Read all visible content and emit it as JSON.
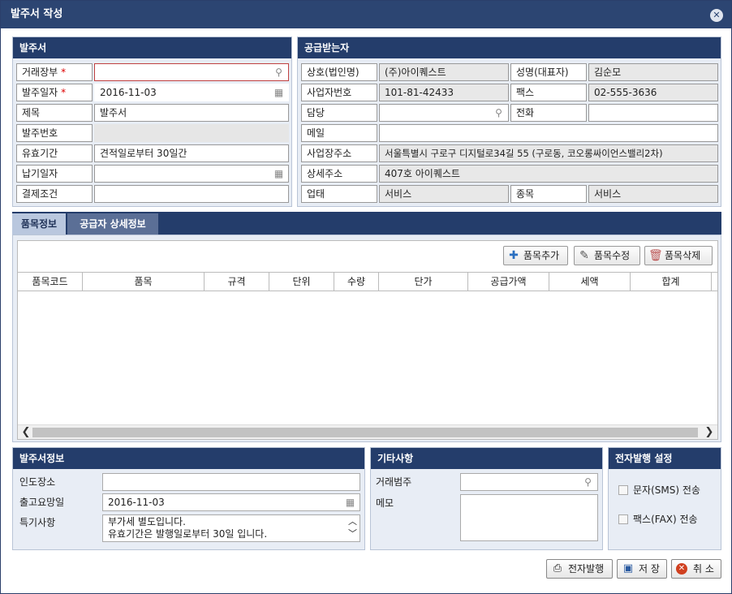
{
  "window": {
    "title": "발주서 작성",
    "close_icon": "close-icon"
  },
  "order": {
    "header": "발주서",
    "fields": [
      {
        "label": "거래장부",
        "required": "*",
        "value": ""
      },
      {
        "label": "발주일자",
        "required": "*",
        "value": "2016-11-03"
      },
      {
        "label": "제목",
        "value": "발주서"
      },
      {
        "label": "발주번호",
        "value": ""
      },
      {
        "label": "유효기간",
        "value": "견적일로부터 30일간"
      },
      {
        "label": "납기일자",
        "value": ""
      },
      {
        "label": "결제조건",
        "value": ""
      }
    ]
  },
  "supplier": {
    "header": "공급받는자",
    "company_label": "상호(법인명)",
    "company_value": "(주)아이퀘스트",
    "ceo_label": "성명(대표자)",
    "ceo_value": "김순모",
    "bizno_label": "사업자번호",
    "bizno_value": "101-81-42433",
    "fax_label": "팩스",
    "fax_value": "02-555-3636",
    "manager_label": "담당",
    "manager_value": "",
    "phone_label": "전화",
    "phone_value": "",
    "email_label": "메일",
    "email_value": "",
    "address_label": "사업장주소",
    "address_value": "서울특별시 구로구 디지털로34길 55 (구로동, 코오롱싸이언스밸리2차)",
    "detail_label": "상세주소",
    "detail_value": "407호 아이퀘스트",
    "biztype_label": "업태",
    "biztype_value": "서비스",
    "item_label": "종목",
    "item_value": "서비스"
  },
  "tabs": [
    "품목정보",
    "공급자 상세정보"
  ],
  "toolbar": {
    "add": "품목추가",
    "edit": "품목수정",
    "delete": "품목삭제"
  },
  "columns": [
    "품목코드",
    "품목",
    "규격",
    "단위",
    "수량",
    "단가",
    "공급가액",
    "세액",
    "합계"
  ],
  "rows": [],
  "orderinfo": {
    "header": "발주서정보",
    "place_label": "인도장소",
    "place_value": "",
    "date_label": "출고요망일",
    "date_value": "2016-11-03",
    "notes_label": "특기사항",
    "notes_line1": "부가세 별도입니다.",
    "notes_line2": "유효기간은 발행일로부터 30일 입니다."
  },
  "etc": {
    "header": "기타사항",
    "category_label": "거래범주",
    "category_value": "",
    "memo_label": "메모",
    "memo_value": ""
  },
  "eissue": {
    "header": "전자발행 설정",
    "sms": "문자(SMS) 전송",
    "fax": "팩스(FAX) 전송"
  },
  "buttons": {
    "issue": "전자발행",
    "save": "저 장",
    "cancel": "취 소"
  }
}
